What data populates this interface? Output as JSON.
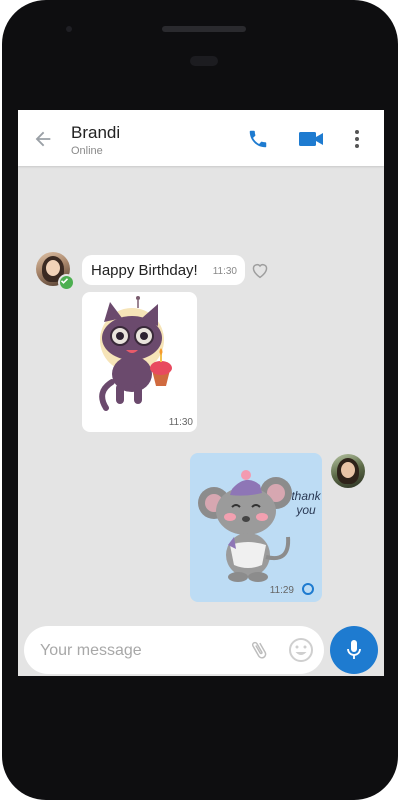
{
  "header": {
    "contact_name": "Brandi",
    "contact_status": "Online",
    "icons": [
      "back-arrow-icon",
      "phone-call-icon",
      "video-call-icon",
      "more-options-icon"
    ]
  },
  "messages": [
    {
      "text": "Happy Birthday!",
      "time": "11:30",
      "direction": "incoming"
    },
    {
      "sticker": "cat-with-cupcake-sticker",
      "time": "11:30",
      "direction": "incoming"
    },
    {
      "sticker": "mouse-thank-you-sticker",
      "sticker_text": "thank you",
      "time": "11:29",
      "direction": "outgoing"
    }
  ],
  "composer": {
    "placeholder": "Your message",
    "value": ""
  },
  "colors": {
    "accent": "#1e7bd0",
    "chat_background": "#e4e4e4",
    "outgoing_sticker_bg": "#bddcf4",
    "verified_badge": "#4caf50"
  }
}
